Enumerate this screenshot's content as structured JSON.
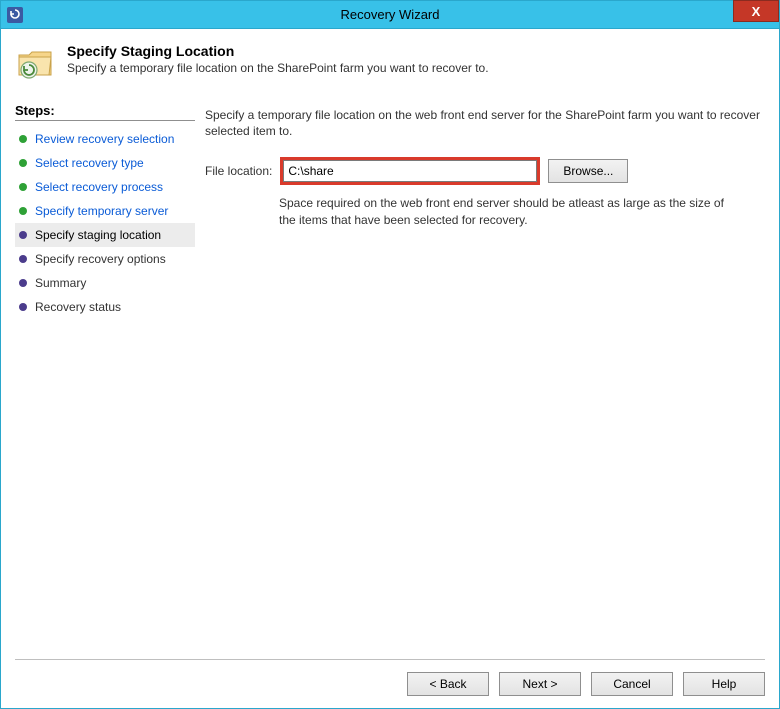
{
  "window": {
    "title": "Recovery Wizard",
    "close_label": "X"
  },
  "header": {
    "title": "Specify Staging Location",
    "subtitle": "Specify a temporary file location on the SharePoint farm you want to recover to."
  },
  "steps": {
    "title": "Steps:",
    "items": [
      {
        "label": "Review recovery selection",
        "state": "completed"
      },
      {
        "label": "Select recovery type",
        "state": "completed"
      },
      {
        "label": "Select recovery process",
        "state": "completed"
      },
      {
        "label": "Specify temporary server",
        "state": "completed"
      },
      {
        "label": "Specify staging location",
        "state": "current"
      },
      {
        "label": "Specify recovery options",
        "state": "upcoming"
      },
      {
        "label": "Summary",
        "state": "upcoming"
      },
      {
        "label": "Recovery status",
        "state": "upcoming"
      }
    ]
  },
  "main": {
    "instruction": "Specify a temporary file location on the web front end server for the SharePoint farm you want to recover selected item to.",
    "file_location_label": "File location:",
    "file_location_value": "C:\\share",
    "browse_label": "Browse...",
    "hint": "Space required on the web front end server should be atleast as large as the size of the items that have been selected for recovery."
  },
  "footer": {
    "back": "< Back",
    "next": "Next >",
    "cancel": "Cancel",
    "help": "Help"
  }
}
